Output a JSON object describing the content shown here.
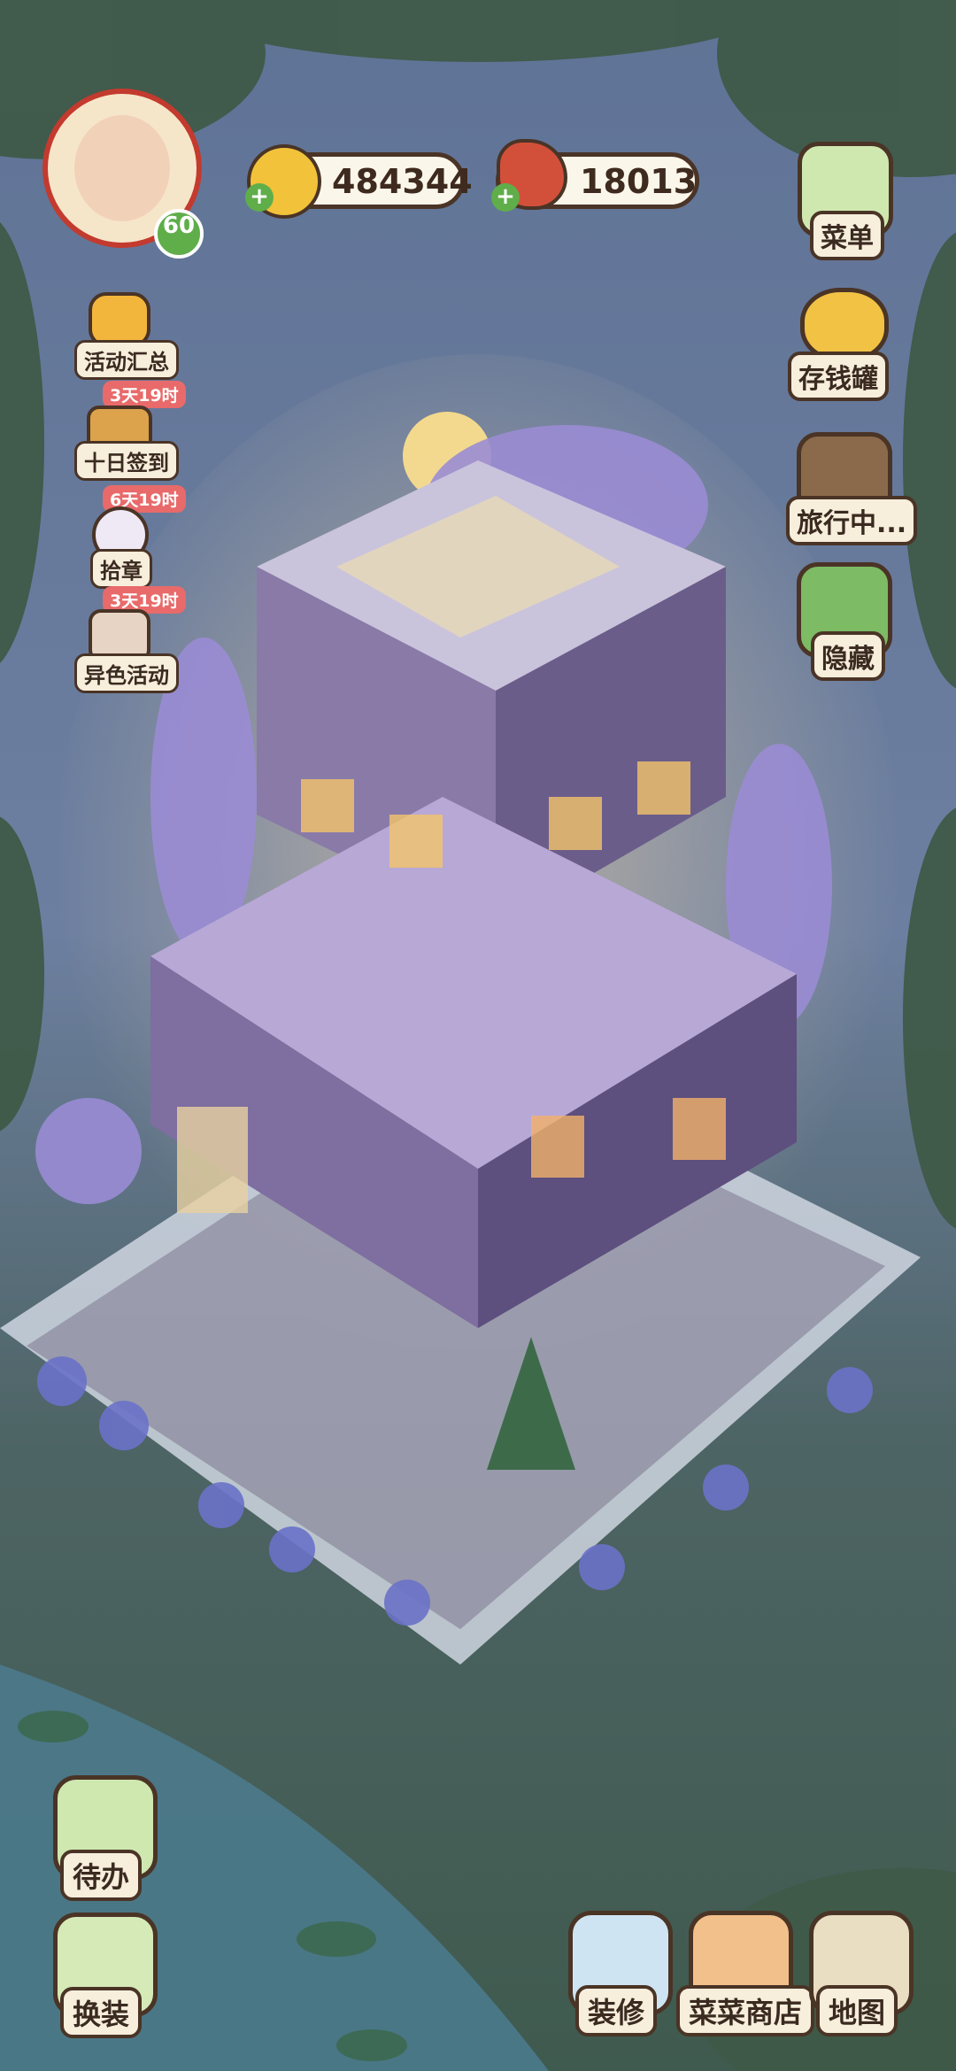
{
  "player": {
    "level": "60",
    "avatar_icon": "character-portrait-icon"
  },
  "currency": {
    "coins": {
      "value": "484344",
      "icon": "gold-coin-icon"
    },
    "food": {
      "value": "18013",
      "icon": "meat-icon"
    }
  },
  "left_menu": [
    {
      "label": "活动汇总",
      "icon": "fruit-basket-icon",
      "badge": ""
    },
    {
      "label": "十日签到",
      "icon": "gift-box-icon",
      "badge": "3天19时"
    },
    {
      "label": "拾章",
      "icon": "badge-icon",
      "badge": "6天19时"
    },
    {
      "label": "异色活动",
      "icon": "card-icon",
      "badge": "3天19时"
    }
  ],
  "right_menu": [
    {
      "label": "菜单",
      "icon": "menu-icon"
    },
    {
      "label": "存钱罐",
      "icon": "piggy-bank-icon"
    },
    {
      "label": "旅行中...",
      "icon": "camera-icon"
    },
    {
      "label": "隐藏",
      "icon": "hide-icon"
    }
  ],
  "bottom_left": [
    {
      "label": "待办",
      "icon": "todo-list-icon"
    },
    {
      "label": "换装",
      "icon": "outfit-icon"
    }
  ],
  "bottom_right": [
    {
      "label": "装修",
      "icon": "decorate-icon"
    },
    {
      "label": "菜菜商店",
      "icon": "shop-icon"
    },
    {
      "label": "地图",
      "icon": "map-icon"
    }
  ],
  "colors": {
    "accent": "#4a3426",
    "badge": "#e86a6a",
    "plus": "#5fae4a"
  }
}
